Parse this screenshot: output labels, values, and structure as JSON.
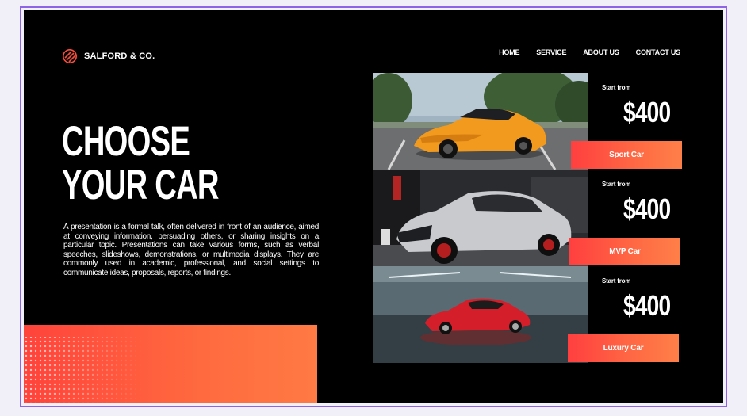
{
  "brand": {
    "name": "SALFORD & CO.",
    "icon": "striped-circle-icon"
  },
  "nav": {
    "items": [
      {
        "label": "HOME"
      },
      {
        "label": "SERVICE"
      },
      {
        "label": "ABOUT US"
      },
      {
        "label": "CONTACT US"
      }
    ]
  },
  "hero": {
    "title_line1": "CHOOSE",
    "title_line2": "YOUR CAR",
    "description": "A presentation is a formal talk, often delivered in front of an audience, aimed at conveying information, persuading others, or sharing insights on a particular topic. Presentations can take various forms, such as verbal speeches, slideshows, demonstrations, or multimedia displays. They are commonly used in academic, professional, and social settings to communicate ideas, proposals, reports, or findings."
  },
  "cars": [
    {
      "photo": "orange-sports-car-photo",
      "start_label": "Start from",
      "price": "$400",
      "button": "Sport Car"
    },
    {
      "photo": "silver-suv-photo",
      "start_label": "Start from",
      "price": "$400",
      "button": "MVP Car"
    },
    {
      "photo": "red-supercar-photo",
      "start_label": "Start from",
      "price": "$400",
      "button": "Luxury Car"
    }
  ],
  "colors": {
    "background": "#000000",
    "accent": "#ff5a3f",
    "frame_border": "#8f63e6",
    "canvas": "#f1f0f8"
  }
}
